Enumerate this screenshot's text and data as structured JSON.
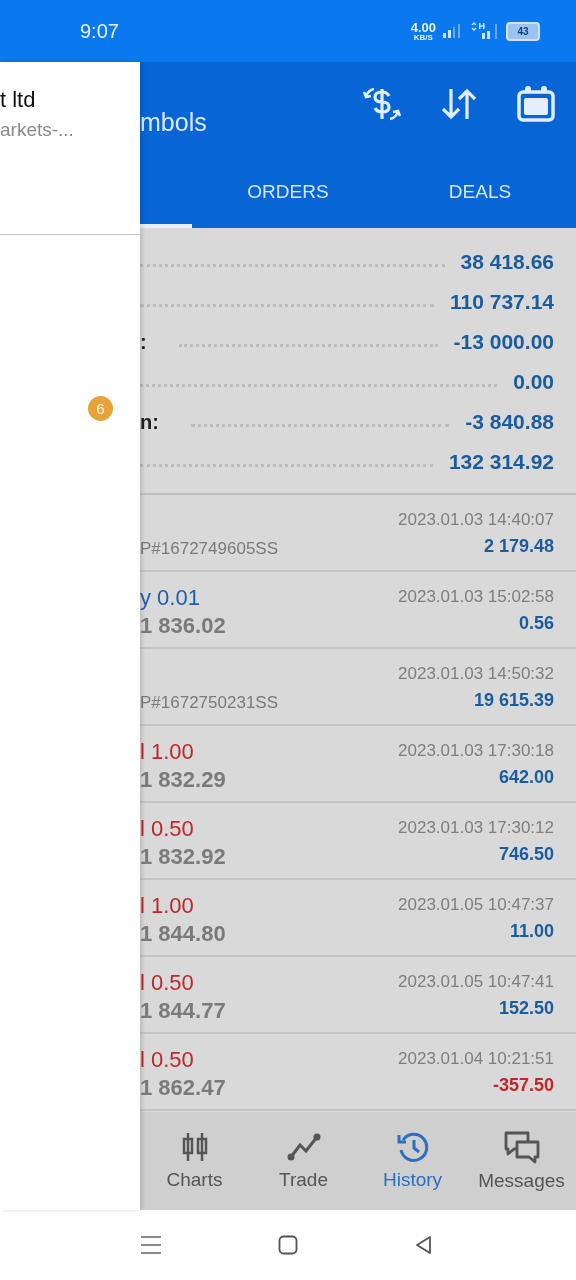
{
  "status_bar": {
    "time": "9:07",
    "speed": "4.00",
    "speed_unit": "KB/S",
    "battery": "43"
  },
  "drawer": {
    "title": "t ltd",
    "subtitle": "arkets-...",
    "badge": "6"
  },
  "app_bar": {
    "title": "mbols"
  },
  "tabs": [
    {
      "selected": true
    },
    {
      "label": "ORDERS",
      "selected": false
    },
    {
      "label": "DEALS",
      "selected": false
    }
  ],
  "summary": [
    {
      "value": "38 418.66"
    },
    {
      "value": "110 737.14"
    },
    {
      "label": ":",
      "value": "-13 000.00"
    },
    {
      "value": "0.00"
    },
    {
      "label": "n:",
      "value": "-3 840.88"
    },
    {
      "value": "132 314.92"
    }
  ],
  "deals": [
    {
      "kind": "balance",
      "comment": "P#1672749605SS",
      "time": "2023.01.03 14:40:07",
      "profit": "2 179.48",
      "negative": false
    },
    {
      "kind": "trade",
      "color": "#1f5fb0",
      "volume": "y 0.01",
      "price": "1 836.02",
      "time": "2023.01.03 15:02:58",
      "profit": "0.56",
      "negative": false
    },
    {
      "kind": "balance",
      "comment": "P#1672750231SS",
      "time": "2023.01.03 14:50:32",
      "profit": "19 615.39",
      "negative": false
    },
    {
      "kind": "trade",
      "color": "#c0262a",
      "volume": "l 1.00",
      "price": "1 832.29",
      "time": "2023.01.03 17:30:18",
      "profit": "642.00",
      "negative": false
    },
    {
      "kind": "trade",
      "color": "#c0262a",
      "volume": "l 0.50",
      "price": "1 832.92",
      "time": "2023.01.03 17:30:12",
      "profit": "746.50",
      "negative": false
    },
    {
      "kind": "trade",
      "color": "#c0262a",
      "volume": "l 1.00",
      "price": "1 844.80",
      "time": "2023.01.05 10:47:37",
      "profit": "11.00",
      "negative": false
    },
    {
      "kind": "trade",
      "color": "#c0262a",
      "volume": "l 0.50",
      "price": "1 844.77",
      "time": "2023.01.05 10:47:41",
      "profit": "152.50",
      "negative": false
    },
    {
      "kind": "trade",
      "color": "#c0262a",
      "volume": "l 0.50",
      "price": "1 862.47",
      "time": "2023.01.04 10:21:51",
      "profit": "-357.50",
      "negative": true
    }
  ],
  "bottom_nav": [
    {
      "kind": "charts",
      "label": "Charts",
      "selected": false
    },
    {
      "kind": "trade",
      "label": "Trade",
      "selected": false
    },
    {
      "kind": "history",
      "label": "History",
      "selected": true
    },
    {
      "kind": "messages",
      "label": "Messages",
      "selected": false
    }
  ]
}
